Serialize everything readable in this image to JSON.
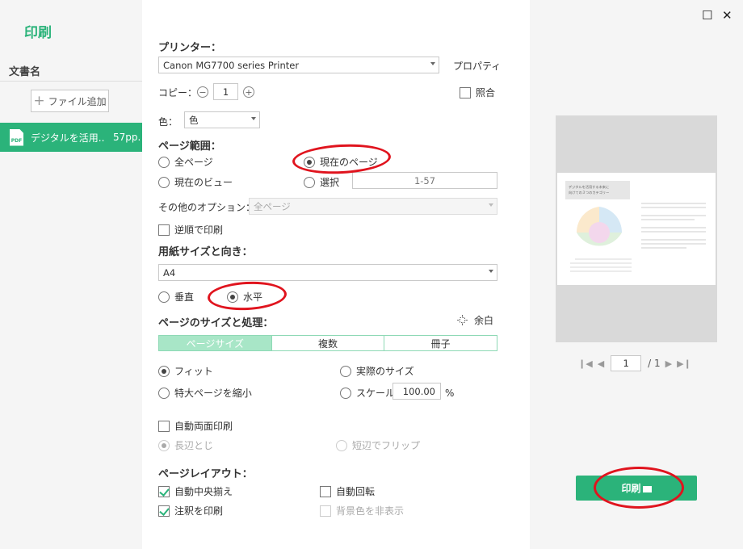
{
  "app": {
    "title": "印刷"
  },
  "left": {
    "doc_heading": "文書名",
    "add_file_label": "ファイル追加",
    "file": {
      "name": "デジタルを活用..",
      "pages": "57pp.",
      "icon": "pdf-file-icon",
      "icon_text": "PDF"
    }
  },
  "printer": {
    "heading": "プリンター：",
    "selected": "Canon MG7700 series Printer",
    "properties_label": "プロパティ"
  },
  "copies": {
    "label": "コピー：",
    "value": "1",
    "collate_label": "照合",
    "collate_checked": false
  },
  "color": {
    "label": "色：",
    "selected": "色"
  },
  "page_range": {
    "heading": "ページ範囲：",
    "all_pages": "全ページ",
    "current_page": "現在のページ",
    "current_view": "現在のビュー",
    "selection": "選択",
    "range_placeholder": "1-57",
    "selected_option": "current_page",
    "other_options_label": "その他のオプション：",
    "other_options_selected": "全ページ",
    "reverse_label": "逆順で印刷",
    "reverse_checked": false
  },
  "paper": {
    "heading": "用紙サイズと向き：",
    "size": "A4",
    "portrait": "垂直",
    "landscape": "水平",
    "orientation": "landscape"
  },
  "sizing": {
    "heading": "ページのサイズと処理：",
    "margin_label": "余白",
    "tabs": [
      "ページサイズ",
      "複数",
      "冊子"
    ],
    "active_tab": "ページサイズ",
    "fit": "フィット",
    "actual_size": "実際のサイズ",
    "shrink_large": "特大ページを縮小",
    "scale": "スケール",
    "scale_value": "100.00",
    "scale_unit": "%",
    "selected_option": "fit"
  },
  "duplex": {
    "label": "自動両面印刷",
    "checked": false,
    "long_edge": "長辺とじ",
    "short_edge": "短辺でフリップ"
  },
  "layout": {
    "heading": "ページレイアウト：",
    "auto_center": "自動中央揃え",
    "auto_center_checked": true,
    "auto_rotate": "自動回転",
    "auto_rotate_checked": false,
    "print_annotations": "注釈を印刷",
    "print_annotations_checked": true,
    "hide_background": "背景色を非表示",
    "hide_background_checked": false
  },
  "preview": {
    "current_page": "1",
    "total_pages": "/ 1",
    "page_title": "デジタルを活用する未来に向けての３つのカテゴリー"
  },
  "print_button": {
    "label": "印刷"
  },
  "window": {
    "maximize": "☐",
    "close": "✕"
  },
  "colors": {
    "accent": "#2bb37a",
    "annotation": "#e0141e"
  }
}
